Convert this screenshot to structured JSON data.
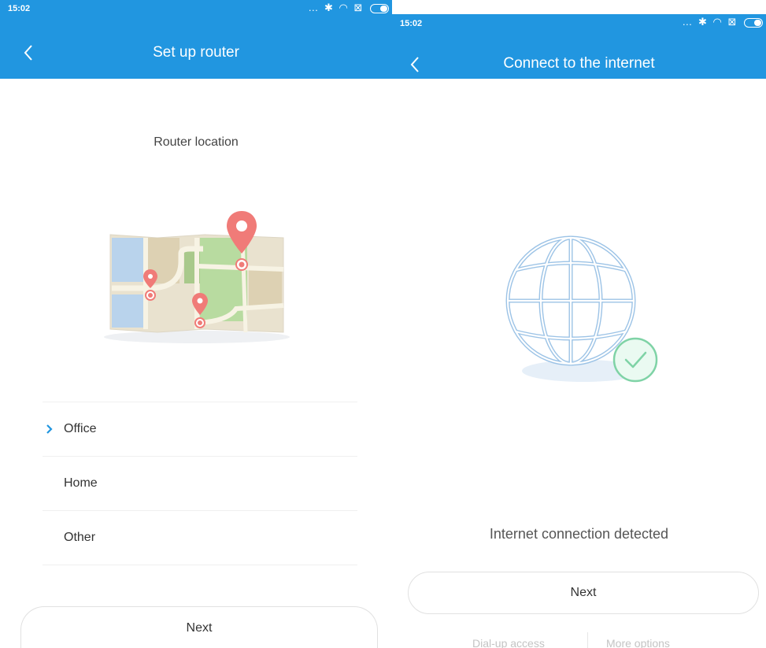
{
  "left_screen": {
    "status": {
      "time": "15:02",
      "icons": [
        "more-dots-icon",
        "bluetooth-icon",
        "wifi-icon",
        "sim-icon",
        "battery-icon"
      ]
    },
    "title": "Set up router",
    "section_title": "Router location",
    "locations": [
      {
        "label": "Office",
        "selected": true
      },
      {
        "label": "Home",
        "selected": false
      },
      {
        "label": "Other",
        "selected": false
      }
    ],
    "next_label": "Next"
  },
  "right_screen": {
    "status": {
      "time": "15:02",
      "icons": [
        "more-dots-icon",
        "bluetooth-icon",
        "wifi-icon",
        "sim-icon",
        "battery-icon"
      ]
    },
    "title": "Connect to the internet",
    "status_message": "Internet connection detected",
    "next_label": "Next",
    "links": {
      "dialup": "Dial-up access",
      "more": "More options"
    }
  },
  "colors": {
    "appbar": "#2196e0",
    "accent": "#2196e0",
    "pin": "#f07b78",
    "globe": "#9cc3e6",
    "success": "#7fd3a6"
  }
}
